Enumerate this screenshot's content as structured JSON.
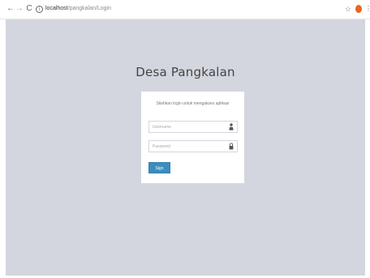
{
  "browser": {
    "url_host": "localhost",
    "url_path": "/pangkalan/Login",
    "back_glyph": "←",
    "forward_glyph": "→",
    "reload_glyph": "C",
    "info_glyph": "i",
    "star_glyph": "☆",
    "menu_glyph": "⋮",
    "icons": [
      "back-icon",
      "forward-icon",
      "reload-icon",
      "info-icon",
      "star-icon",
      "profile-avatar",
      "menu-icon"
    ]
  },
  "login": {
    "title": "Desa Pangkalan",
    "message": "Silahkan login untuk mengakses aplikasi",
    "username_placeholder": "Username",
    "password_placeholder": "Password",
    "signin_label": "Sign In",
    "field_icons": [
      "user-icon",
      "lock-icon"
    ]
  },
  "colors": {
    "page_background": "#d3d6de",
    "primary_button": "#3c8dbc",
    "box_background": "#ffffff",
    "avatar": "#e8671c"
  }
}
